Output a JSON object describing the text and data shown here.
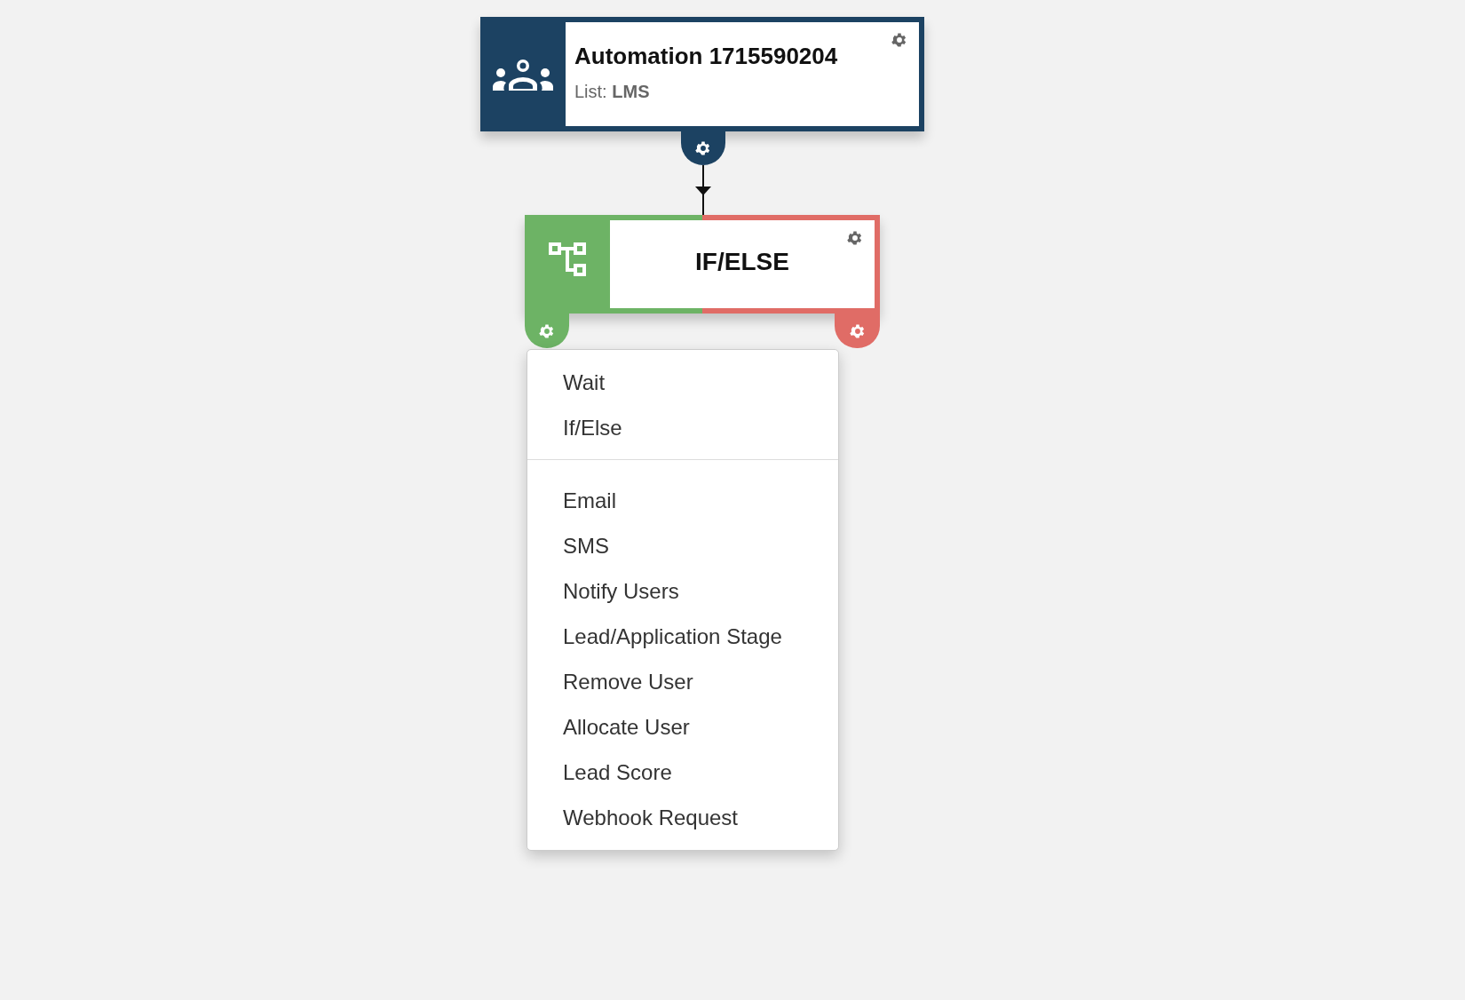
{
  "trigger": {
    "title": "Automation 1715590204",
    "list_label": "List:",
    "list_value": "LMS"
  },
  "condition": {
    "title": "IF/ELSE"
  },
  "menu": {
    "groups": [
      {
        "items": [
          {
            "label": "Wait"
          },
          {
            "label": "If/Else"
          }
        ]
      },
      {
        "items": [
          {
            "label": "Email"
          },
          {
            "label": "SMS"
          },
          {
            "label": "Notify Users"
          },
          {
            "label": "Lead/Application Stage"
          },
          {
            "label": "Remove User"
          },
          {
            "label": "Allocate User"
          },
          {
            "label": "Lead Score"
          },
          {
            "label": "Webhook Request"
          }
        ]
      }
    ]
  }
}
